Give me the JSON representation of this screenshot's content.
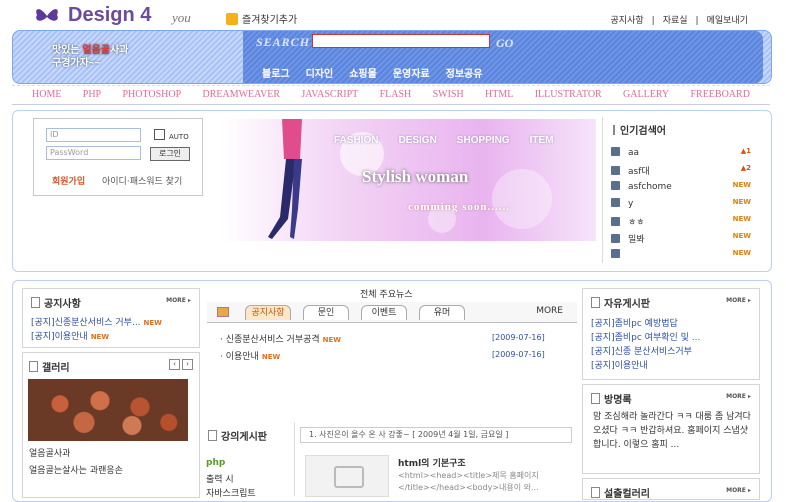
{
  "header": {
    "logo": "Design 4",
    "logo_script": "you",
    "favorite": "즐겨찾기추가",
    "links": [
      "공지사항",
      "|",
      "자료실",
      "|",
      "메일보내기"
    ]
  },
  "banner": {
    "tagline_1": "맛있는 ",
    "tagline_hl": "얼음골",
    "tagline_2": "사과",
    "tagline_3": "구경가자~~",
    "search_label": "SEARCH",
    "search_value": "",
    "go_label": "GO",
    "menu": [
      "블로그",
      "디자인",
      "쇼핑몰",
      "운영자료",
      "정보공유"
    ]
  },
  "categories": [
    "HOME",
    "PHP",
    "PHOTOSHOP",
    "DREAMWEAVER",
    "JAVASCRIPT",
    "FLASH",
    "SWISH",
    "HTML",
    "ILLUSTRATOR",
    "GALLERY",
    "FREEBOARD"
  ],
  "login": {
    "id_placeholder": "ID",
    "pw_placeholder": "PassWord",
    "auto": "AUTO",
    "button": "로그인",
    "join": "회원가입",
    "find": "아이디·패스워드 찾기"
  },
  "main_banner": {
    "nav": [
      "FASHION",
      "DESIGN",
      "SHOPPING",
      "ITEM"
    ],
    "title": "Stylish woman",
    "subtitle": "comming soon......"
  },
  "popular": {
    "title": "인기검색어",
    "items": [
      {
        "rank": "1",
        "term": "aa",
        "change": "▲1",
        "color": "#e05010"
      },
      {
        "rank": "2",
        "term": "asf대",
        "change": "▲2",
        "color": "#e05010"
      },
      {
        "rank": "3",
        "term": "asfchome",
        "change": "NEW",
        "color": "#e08010"
      },
      {
        "rank": "4",
        "term": "y",
        "change": "NEW",
        "color": "#e08010"
      },
      {
        "rank": "5",
        "term": "ㅎㅎ",
        "change": "NEW",
        "color": "#e08010"
      },
      {
        "rank": "6",
        "term": "밀봐",
        "change": "NEW",
        "color": "#e08010"
      },
      {
        "rank": "7",
        "term": "",
        "change": "NEW",
        "color": "#e08010"
      }
    ]
  },
  "notice": {
    "title": "공지사항",
    "more": "MORE",
    "items": [
      "[공지]신종분산서비스 거부...",
      "[공지]이용안내"
    ],
    "new": "NEW"
  },
  "gallery": {
    "title": "갤러리",
    "arrows": [
      "‹",
      "›"
    ],
    "caption_1": "얼음골사과",
    "caption_2": "얼음골는살사는 과랜응손"
  },
  "center": {
    "title": "전체 주요뉴스",
    "tabs": [
      "공지사항",
      "문인",
      "이벤트",
      "유머"
    ],
    "more": "MORE",
    "items": [
      {
        "title": "· 신종분산서비스 거부공격",
        "date": "[2009-07-16]"
      },
      {
        "title": "· 이용안내",
        "date": "[2009-07-16]"
      }
    ],
    "new": "NEW"
  },
  "lecture": {
    "title": "강의게시판",
    "category": "php",
    "item_1": "출력 시",
    "item_2": "자바스크립트",
    "notice": "1. 사진은이 올수 온 사 강좋~ [ 2009년 4월 1일, 금요일 ]",
    "article_title": "html의 기본구조",
    "article_body": "<html><head><title>제목 홈페이지</title></head><body>내용이 와..."
  },
  "freeboard": {
    "title": "자유게시판",
    "more": "MORE",
    "items": [
      "[공지]좀비pc 예방법답",
      "[공지]좀비pc 여부확인 및 ...",
      "[공지]신종 분산서비스거부",
      "[공지]이용안내"
    ]
  },
  "guestbook": {
    "title": "방명록",
    "more": "MORE",
    "text": "맘 조심해라 놀라간다 ㅋㅋ 대룸 좀 남겨다 오셨다 ㅋㅋ 반갑하셔요. 홈페이지 스냅샷합니다. 이렇으 홈피 ..."
  },
  "third_box": {
    "title": "설출컬러리",
    "more": "MORE"
  }
}
